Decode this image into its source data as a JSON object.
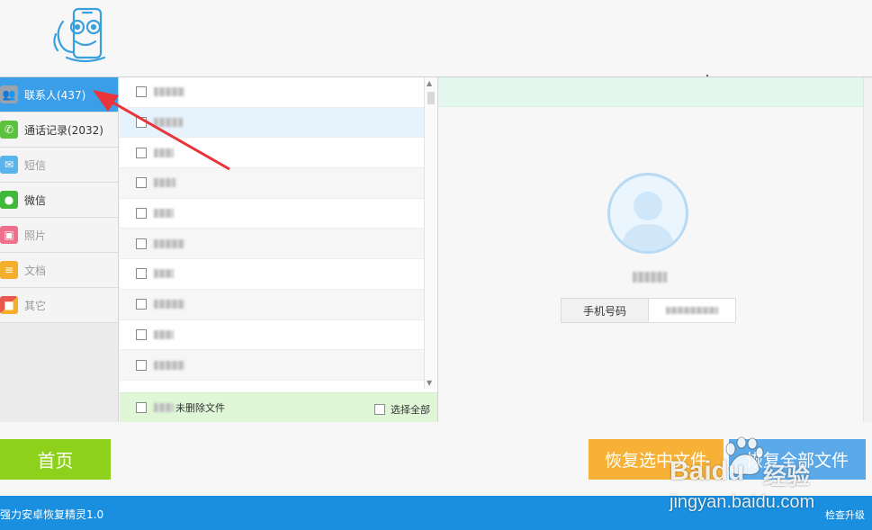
{
  "sidebar": {
    "items": [
      {
        "label": "联系人(437)",
        "icon": "contacts-icon",
        "color": "#9aa3ad",
        "active": true
      },
      {
        "label": "通话记录(2032)",
        "icon": "phone-call-icon",
        "color": "#5cc13c"
      },
      {
        "label": "短信",
        "icon": "sms-icon",
        "color": "#5ab4ec",
        "disabled": true
      },
      {
        "label": "微信",
        "icon": "wechat-icon",
        "color": "#40b83a"
      },
      {
        "label": "照片",
        "icon": "photo-icon",
        "color": "#ef6f8c",
        "disabled": true
      },
      {
        "label": "文档",
        "icon": "document-icon",
        "color": "#f3ae2a",
        "disabled": true
      },
      {
        "label": "其它",
        "icon": "apps-icon",
        "color": "#e9574e",
        "disabled": true
      }
    ]
  },
  "list": {
    "footer_label": "未删除文件",
    "select_all_label": "选择全部"
  },
  "detail": {
    "phone_label": "手机号码"
  },
  "buttons": {
    "home": "首页",
    "recover_selected": "恢复选中文件",
    "recover_all": "恢复全部文件"
  },
  "statusbar": {
    "app_name": "强力安卓恢复精灵1.0",
    "upgrade": "检查升级"
  },
  "watermark": {
    "brand": "Baidu",
    "brand_cn": "经验",
    "url": "jingyan.baidu.com"
  },
  "colors": {
    "accent": "#3a9ee8",
    "home_button": "#8dd11d",
    "recover_selected": "#f6b136",
    "recover_all": "#5ba9e8",
    "statusbar": "#1a8fe0",
    "annotation_arrow": "#e8343a"
  }
}
